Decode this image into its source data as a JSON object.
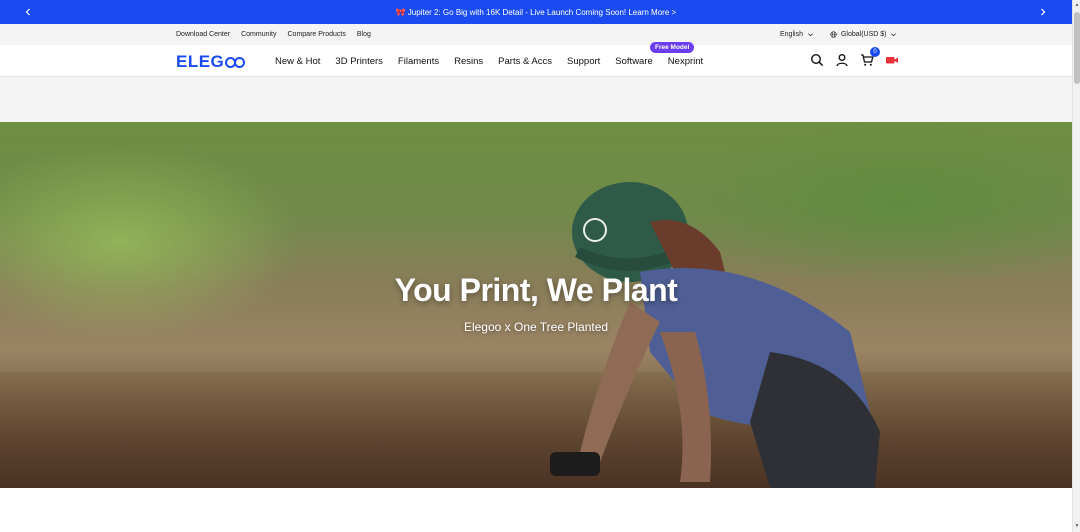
{
  "announcement": {
    "emoji": "🎀",
    "text": "Jupiter 2: Go Big with 16K Detail - Live Launch Coming Soon! Learn More >"
  },
  "utility": {
    "links": [
      "Download Center",
      "Community",
      "Compare Products",
      "Blog"
    ],
    "language": "English",
    "region": "Global(USD $)"
  },
  "header": {
    "logo": "ELEG",
    "nav": [
      "New & Hot",
      "3D Printers",
      "Filaments",
      "Resins",
      "Parts & Accs",
      "Support",
      "Software",
      "Nexprint"
    ],
    "badge": "Free Model",
    "cart_count": "0"
  },
  "hero": {
    "title": "You Print, We Plant",
    "subtitle": "Elegoo x One Tree Planted"
  },
  "colors": {
    "brand": "#1a4bf0",
    "badge": "#6a3df0"
  },
  "icons": [
    "chevron-left-icon",
    "chevron-right-icon",
    "chevron-down-icon",
    "globe-icon",
    "search-icon",
    "user-icon",
    "cart-icon",
    "video-camera-icon"
  ]
}
